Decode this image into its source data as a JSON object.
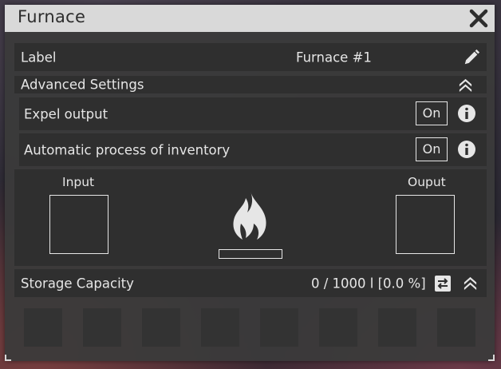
{
  "window": {
    "title": "Furnace"
  },
  "label_row": {
    "label": "Label",
    "value": "Furnace #1",
    "edit_icon": "pencil-icon"
  },
  "advanced": {
    "label": "Advanced Settings",
    "collapse_icon": "double-chevron-up-icon"
  },
  "settings": [
    {
      "label": "Expel output",
      "toggle": "On",
      "info_icon": "info-icon"
    },
    {
      "label": "Automatic process of inventory",
      "toggle": "On",
      "info_icon": "info-icon"
    }
  ],
  "io": {
    "input_label": "Input",
    "output_label": "Ouput",
    "flame_icon": "flame-icon",
    "progress": 0
  },
  "storage": {
    "label": "Storage Capacity",
    "value": "0 / 1000 l [0.0 %]",
    "transfer_icon": "transfer-icon",
    "collapse_icon": "double-chevron-up-icon"
  },
  "inventory": {
    "slot_count": 8
  },
  "colors": {
    "titlebar": "#d9d9d9",
    "panel": "#3a3a3a",
    "row": "#2f2f2f",
    "text": "#e6e6e6"
  }
}
